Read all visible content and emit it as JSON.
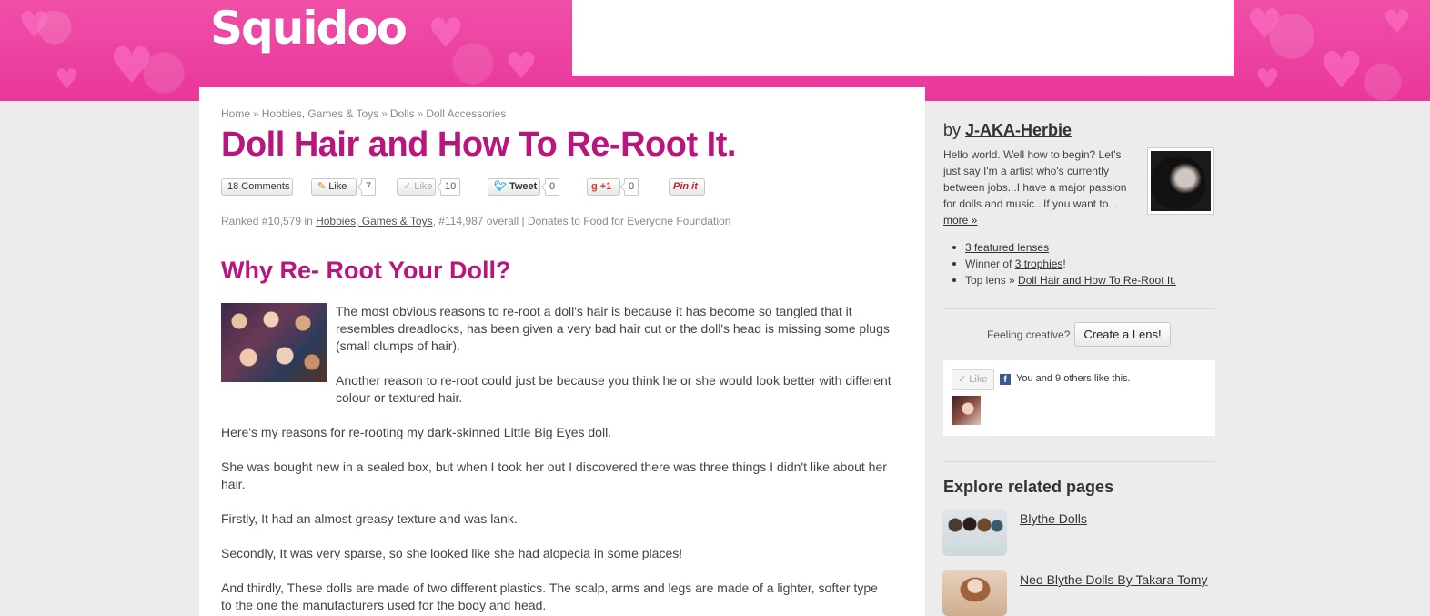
{
  "header": {
    "logo": "Squidoo"
  },
  "breadcrumb": {
    "items": [
      "Home",
      "Hobbies, Games & Toys",
      "Dolls",
      "Doll Accessories"
    ],
    "separator": "»"
  },
  "page_title": "Doll Hair and How To Re-Root It.",
  "share_bar": {
    "comments_label": "18 Comments",
    "like1_label": "Like",
    "like1_count": "7",
    "like2_label": "Like",
    "like2_count": "10",
    "tweet_label": "Tweet",
    "tweet_count": "0",
    "plusone_label": "+1",
    "plusone_count": "0",
    "pinit_label": "Pin it"
  },
  "ranked": {
    "prefix": "Ranked #10,579 in",
    "category": "Hobbies, Games & Toys",
    "suffix": ", #114,987 overall | Donates to Food for Everyone Foundation"
  },
  "section": {
    "title": "Why Re- Root Your Doll?",
    "paragraphs": [
      "The most obvious reasons to re-root a doll's hair is because it has become so tangled that it",
      "resembles dreadlocks, has been given a very bad hair cut or the doll's head is missing some plugs",
      "(small clumps of hair).",
      "Another reason to re-root could just be because you think he or she would look better with different",
      "colour or textured hair.",
      "Here's my reasons for re-rooting my dark-skinned Little Big Eyes doll.",
      "She was bought new in a sealed box, but when I took her out I discovered there was three things I didn't like about her",
      "hair.",
      "Firstly, It had an almost greasy texture and was lank.",
      "Secondly, It was very sparse, so she looked like she had alopecia in some places!",
      "And thirdly, These dolls are made of two different plastics. The scalp, arms and legs are made of a lighter, softer type",
      "to the one the manufacturers used for the body and head."
    ]
  },
  "sidebar": {
    "by_prefix": "by",
    "author": "J-AKA-Herbie",
    "bio_lines": [
      "Hello world. Well how to begin? Let's",
      "just say I'm a artist who's currently",
      "between jobs...I have a major passion",
      "for dolls and music...If you want to..."
    ],
    "more_link": "more »",
    "stats": {
      "featured": "3 featured lenses",
      "winner_prefix": "Winner of",
      "trophies": "3 trophies",
      "winner_suffix": "!",
      "toplens_prefix": "Top lens »",
      "toplens": "Doll Hair and How To Re-Root It."
    },
    "feeling_creative": "Feeling creative?",
    "create_button": "Create a Lens!",
    "fb": {
      "like_label": "Like",
      "f_letter": "f",
      "text": "You and 9 others like this."
    },
    "explore_title": "Explore related pages",
    "related": [
      {
        "title": "Blythe Dolls"
      },
      {
        "title": "Neo Blythe Dolls By Takara Tomy"
      }
    ]
  },
  "colors": {
    "brand_pink": "#e9379b",
    "title_magenta": "#b8157d"
  }
}
